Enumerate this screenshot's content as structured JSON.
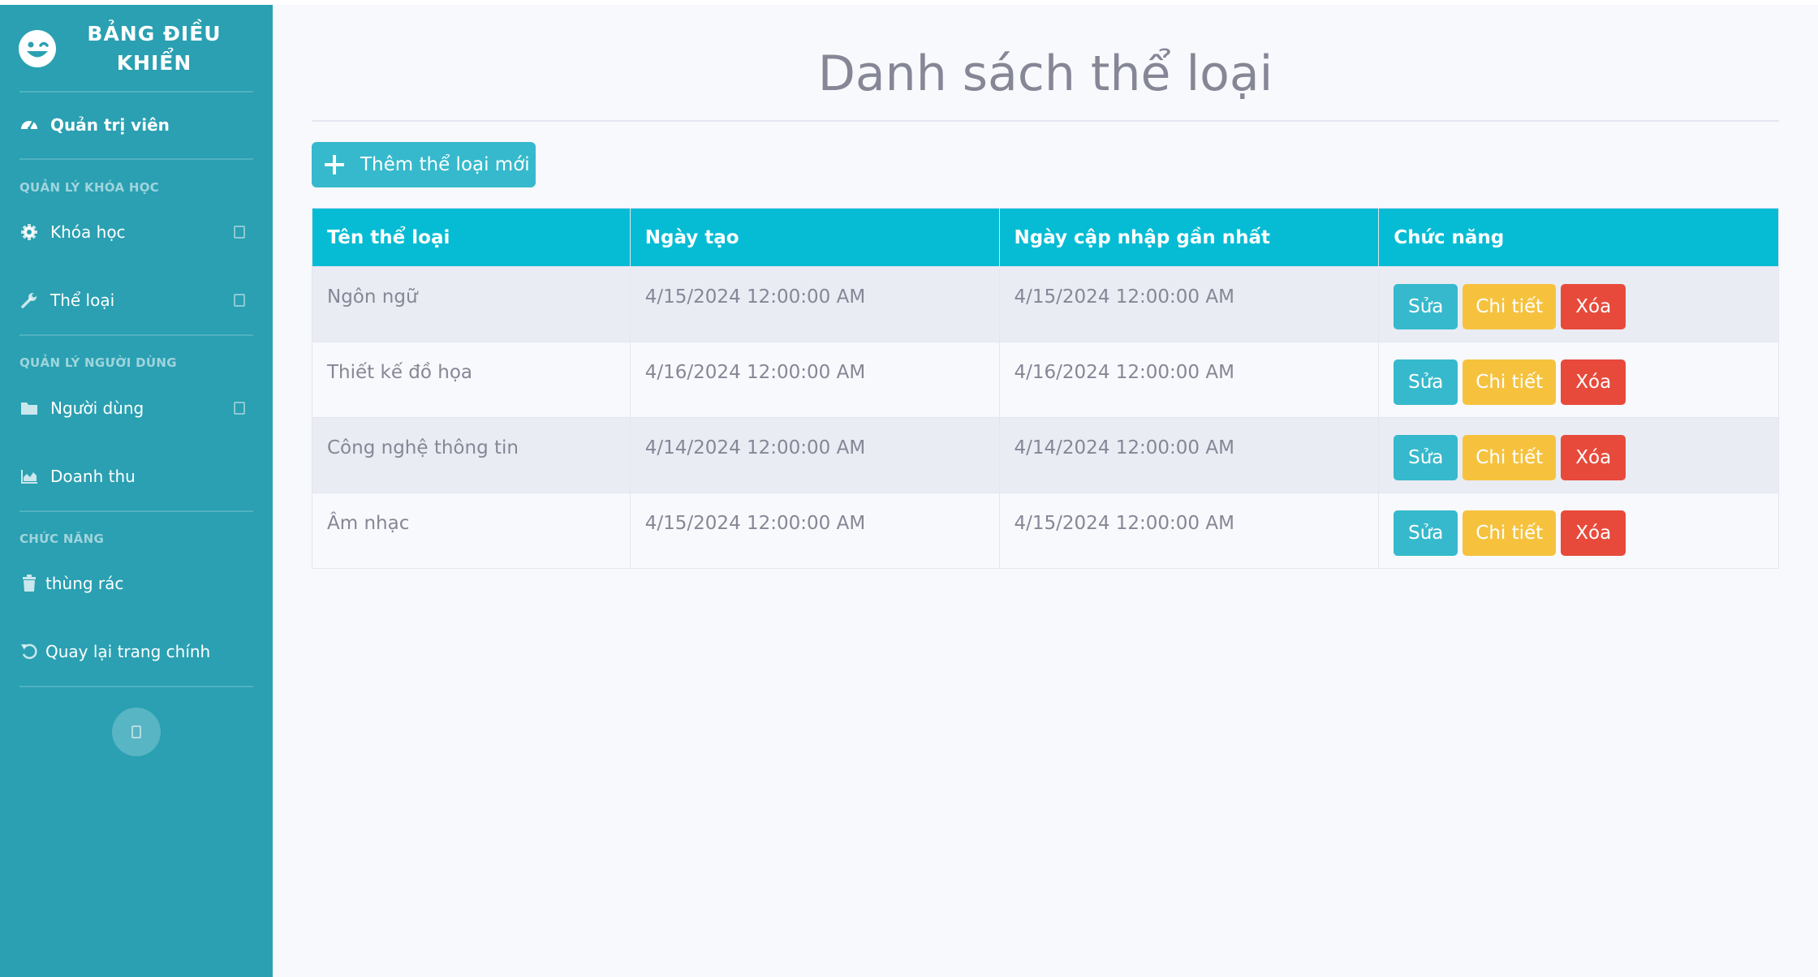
{
  "sidebar": {
    "brand": {
      "line1": "BẢNG ĐIỀU",
      "line2": "KHIỂN",
      "icon": "laugh-wink-icon"
    },
    "dashboard": {
      "label": "Quản trị viên",
      "icon": "tachometer-icon"
    },
    "sections": [
      {
        "heading": "QUẢN LÝ KHÓA HỌC"
      },
      {
        "heading": "QUẢN LÝ NGƯỜI DÙNG"
      },
      {
        "heading": "CHỨC NĂNG"
      }
    ],
    "items": [
      {
        "label": "Khóa học",
        "icon": "cog-icon"
      },
      {
        "label": "Thể loại",
        "icon": "wrench-icon"
      },
      {
        "label": "Người dùng",
        "icon": "folder-icon"
      },
      {
        "label": "Doanh thu",
        "icon": "area-chart-icon"
      },
      {
        "label": "thùng rác",
        "icon": "trash-icon"
      },
      {
        "label": "Quay lại trang chính",
        "icon": "undo-icon"
      }
    ]
  },
  "main": {
    "title": "Danh sách thể loại",
    "add_button": "Thêm thể loại mới",
    "table": {
      "headers": [
        "Tên thể loại",
        "Ngày tạo",
        "Ngày cập nhập gần nhất",
        "Chức năng"
      ],
      "rows": [
        {
          "name": "Ngôn ngữ",
          "created": "4/15/2024 12:00:00 AM",
          "updated": "4/15/2024 12:00:00 AM"
        },
        {
          "name": "Thiết kế đồ họa",
          "created": "4/16/2024 12:00:00 AM",
          "updated": "4/16/2024 12:00:00 AM"
        },
        {
          "name": "Công nghệ thông tin",
          "created": "4/14/2024 12:00:00 AM",
          "updated": "4/14/2024 12:00:00 AM"
        },
        {
          "name": "Âm nhạc",
          "created": "4/15/2024 12:00:00 AM",
          "updated": "4/15/2024 12:00:00 AM"
        }
      ],
      "actions": {
        "edit": "Sửa",
        "detail": "Chi tiết",
        "delete": "Xóa"
      }
    }
  },
  "colors": {
    "sidebar": "#2aa0b2",
    "header": "#06bcd4",
    "edit": "#36b9cc",
    "detail": "#f6c23e",
    "delete": "#e74a3b"
  }
}
